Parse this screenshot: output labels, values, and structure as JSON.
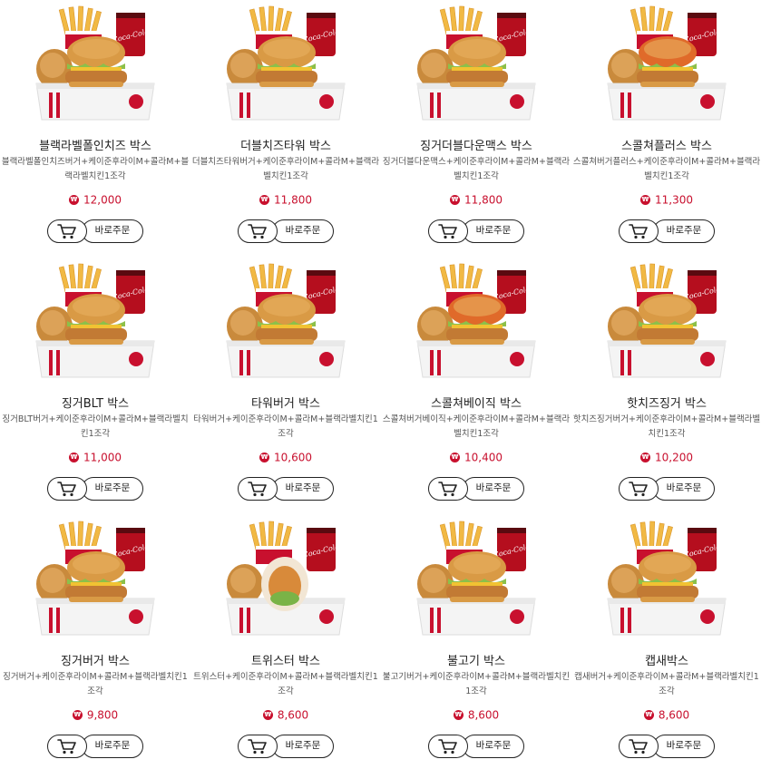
{
  "currency_symbol": "₩",
  "colors": {
    "price": "#c8102e",
    "brand_red": "#c8102e"
  },
  "products": [
    {
      "name": "블랙라벨폴인치즈 박스",
      "desc": "블랙라벨폴인치즈버거+케이준후라이M+콜라M+블랙라벨치킨1조각",
      "price": "12,000",
      "cart_icon": "cart-icon",
      "order_label": "바로주문"
    },
    {
      "name": "더블치즈타워 박스",
      "desc": "더블치즈타워버거+케이준후라이M+콜라M+블랙라벨치킨1조각",
      "price": "11,800",
      "cart_icon": "cart-icon",
      "order_label": "바로주문"
    },
    {
      "name": "징거더블다운맥스 박스",
      "desc": "징거더블다운맥스+케이준후라이M+콜라M+블랙라벨치킨1조각",
      "price": "11,800",
      "cart_icon": "cart-icon",
      "order_label": "바로주문"
    },
    {
      "name": "스콜쳐플러스 박스",
      "desc": "스콜쳐버거플러스+케이준후라이M+콜라M+블랙라벨치킨1조각",
      "price": "11,300",
      "cart_icon": "cart-icon",
      "order_label": "바로주문"
    },
    {
      "name": "징거BLT 박스",
      "desc": "징거BLT버거+케이준후라이M+콜라M+블랙라벨치킨1조각",
      "price": "11,000",
      "cart_icon": "cart-icon",
      "order_label": "바로주문"
    },
    {
      "name": "타워버거 박스",
      "desc": "타워버거+케이준후라이M+콜라M+블랙라벨치킨1조각",
      "price": "10,600",
      "cart_icon": "cart-icon",
      "order_label": "바로주문"
    },
    {
      "name": "스콜쳐베이직 박스",
      "desc": "스콜쳐버거베이직+케이준후라이M+콜라M+블랙라벨치킨1조각",
      "price": "10,400",
      "cart_icon": "cart-icon",
      "order_label": "바로주문"
    },
    {
      "name": "핫치즈징거 박스",
      "desc": "핫치즈징거버거+케이준후라이M+콜라M+블랙라벨치킨1조각",
      "price": "10,200",
      "cart_icon": "cart-icon",
      "order_label": "바로주문"
    },
    {
      "name": "징거버거 박스",
      "desc": "징거버거+케이준후라이M+콜라M+블랙라벨치킨1조각",
      "price": "9,800",
      "cart_icon": "cart-icon",
      "order_label": "바로주문"
    },
    {
      "name": "트위스터 박스",
      "desc": "트위스터+케이준후라이M+콜라M+블랙라벨치킨1조각",
      "price": "8,600",
      "cart_icon": "cart-icon",
      "order_label": "바로주문"
    },
    {
      "name": "불고기 박스",
      "desc": "불고기버거+케이준후라이M+콜라M+블랙라벨치킨1조각",
      "price": "8,600",
      "cart_icon": "cart-icon",
      "order_label": "바로주문"
    },
    {
      "name": "캡새박스",
      "desc": "캡새버거+케이준후라이M+콜라M+블랙라벨치킨1조각",
      "price": "8,600",
      "cart_icon": "cart-icon",
      "order_label": "바로주문"
    }
  ]
}
